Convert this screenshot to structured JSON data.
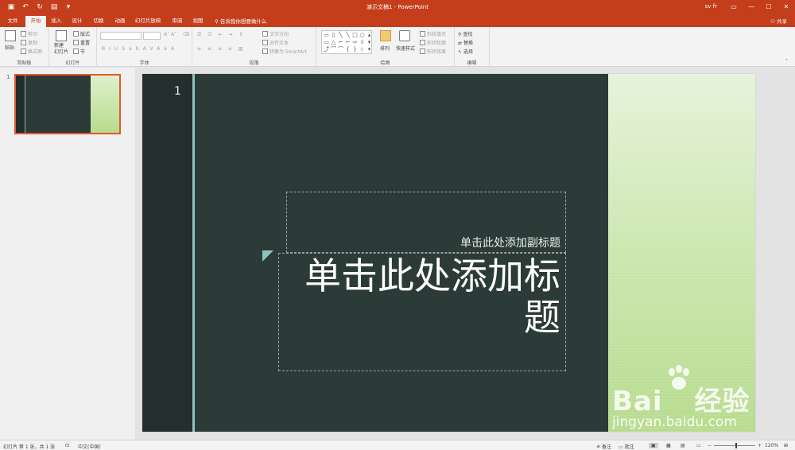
{
  "titlebar": {
    "title": "演示文稿1  -  PowerPoint",
    "user": "sv fr",
    "qat": [
      "save-icon",
      "undo-icon",
      "redo-icon",
      "start-from-beginning-icon",
      "customize-icon"
    ],
    "controls": [
      "ribbon-display-icon",
      "minimize-icon",
      "maximize-icon",
      "close-icon"
    ]
  },
  "tabs": [
    "文件",
    "开始",
    "插入",
    "设计",
    "切换",
    "动画",
    "幻灯片放映",
    "审阅",
    "视图"
  ],
  "tell_me": "告诉我你想要做什么",
  "share": "共享",
  "ribbon": {
    "clipboard": {
      "label": "剪贴板",
      "paste": "粘贴",
      "cut": "剪切",
      "copy": "复制",
      "format_painter": "格式刷"
    },
    "slides": {
      "label": "幻灯片",
      "new_slide": "新建\n幻灯片",
      "layout": "版式",
      "reset": "重置",
      "section": "节"
    },
    "font": {
      "label": "字体",
      "buttons": [
        "B",
        "I",
        "U",
        "S",
        "ab",
        "AV",
        "Aa",
        "A"
      ]
    },
    "paragraph": {
      "label": "段落",
      "text_direction": "文字方向",
      "align_text": "对齐文本",
      "smartart": "转换为 SmartArt"
    },
    "drawing": {
      "label": "绘图",
      "arrange": "排列",
      "quick_styles": "快速样式",
      "shape_fill": "形状填充",
      "shape_outline": "形状轮廓",
      "shape_effects": "形状效果"
    },
    "editing": {
      "label": "编辑",
      "find": "查找",
      "replace": "替换",
      "select": "选择"
    }
  },
  "thumbnail": {
    "number": "1"
  },
  "slide": {
    "number": "1",
    "subtitle": "单击此处添加副标题",
    "title": "单击此处添加标题"
  },
  "watermark": {
    "brand": "Bai",
    "brand2": "经验",
    "url": "jingyan.baidu.com"
  },
  "statusbar": {
    "slide_info": "幻灯片 第 1 张，共 1 张",
    "language": "中文(中国)",
    "notes": "备注",
    "comments": "批注",
    "zoom": "120%"
  }
}
